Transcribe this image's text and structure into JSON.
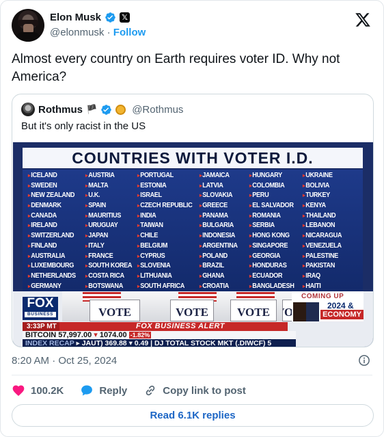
{
  "author": {
    "name": "Elon Musk",
    "handle": "@elonmusk",
    "separator": "·",
    "follow_label": "Follow"
  },
  "tweet": {
    "text": "Almost every country on Earth requires voter ID. Why not America?",
    "timestamp": "8:20 AM · Oct 25, 2024"
  },
  "quoted": {
    "name": "Rothmus",
    "handle": "@Rothmus",
    "text": "But it's only racist in the US",
    "image": {
      "title": "COUNTRIES WITH VOTER I.D.",
      "columns": [
        [
          "ICELAND",
          "SWEDEN",
          "NEW ZEALAND",
          "DENMARK",
          "CANADA",
          "IRELAND",
          "SWITZERLAND",
          "FINLAND",
          "AUSTRALIA",
          "LUXEMBOURG",
          "NETHERLANDS",
          "GERMANY"
        ],
        [
          "AUSTRIA",
          "MALTA",
          "U.K.",
          "SPAIN",
          "MAURITIUS",
          "URUGUAY",
          "JAPAN",
          "ITALY",
          "FRANCE",
          "SOUTH KOREA",
          "COSTA RICA",
          "BOTSWANA"
        ],
        [
          "PORTUGAL",
          "ESTONIA",
          "ISRAEL",
          "CZECH REPUBLIC",
          "INDIA",
          "TAIWAN",
          "CHILE",
          "BELGIUM",
          "CYPRUS",
          "SLOVENIA",
          "LITHUANIA",
          "SOUTH AFRICA"
        ],
        [
          "JAMAICA",
          "LATVIA",
          "SLOVAKIA",
          "GREECE",
          "PANAMA",
          "BULGARIA",
          "INDONESIA",
          "ARGENTINA",
          "POLAND",
          "BRAZIL",
          "GHANA",
          "CROATIA"
        ],
        [
          "HUNGARY",
          "COLOMBIA",
          "PERU",
          "EL SALVADOR",
          "ROMANIA",
          "SERBIA",
          "HONG KONG",
          "SINGAPORE",
          "GEORGIA",
          "HONDURAS",
          "ECUADOR",
          "BANGLADESH"
        ],
        [
          "UKRAINE",
          "BOLIVIA",
          "TURKEY",
          "KENYA",
          "THAILAND",
          "LEBANON",
          "NICARAGUA",
          "VENEZUELA",
          "PALESTINE",
          "PAKISTAN",
          "IRAQ",
          "HAITI"
        ]
      ],
      "network_logo": "FOX",
      "network_sub": "BUSINESS",
      "vote_sign": "VOTE",
      "coming_up": "COMING UP",
      "coming_year": "2024 &",
      "coming_topic": "ECONOMY",
      "alert_time": "3:33P MT",
      "alert_text": "FOX BUSINESS ALERT",
      "ticker_bitcoin": "BITCOIN 57,997.00",
      "ticker_change": "1074.00",
      "ticker_pct": "-1.82%",
      "ticker_index": "INDEX RECAP",
      "ticker_index_values": "JAUT) 369.88 ▾ 0.49 | DJ TOTAL STOCK MKT (.DIWCF) 5"
    }
  },
  "actions": {
    "likes": "100.2K",
    "reply_label": "Reply",
    "copy_label": "Copy link to post",
    "read_replies": "Read 6.1K replies"
  },
  "colors": {
    "accent": "#1d9bf0",
    "like": "#f91880",
    "muted": "#536471"
  }
}
